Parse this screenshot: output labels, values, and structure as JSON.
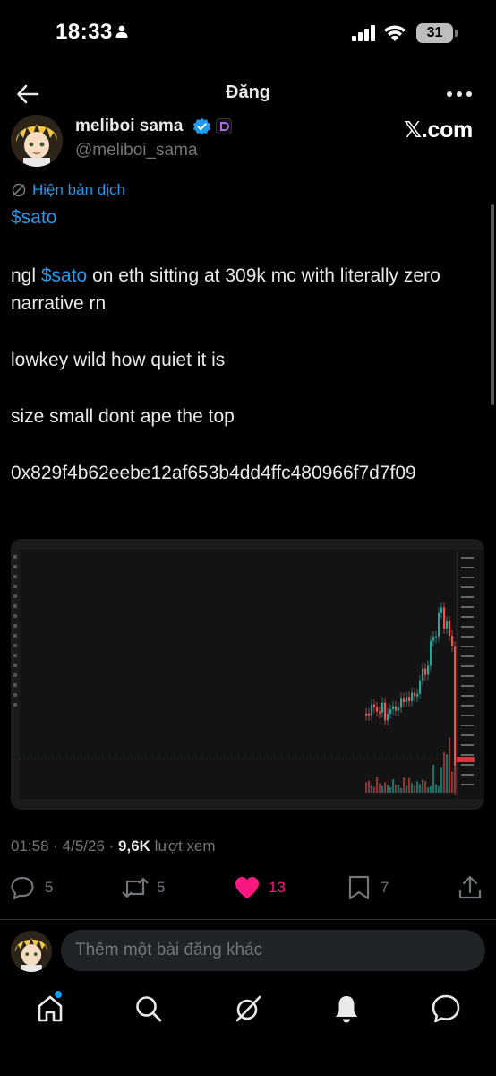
{
  "status_bar": {
    "time": "18:33",
    "battery": "31"
  },
  "header": {
    "title": "Đăng"
  },
  "author": {
    "name": "meliboi sama",
    "handle": "@meliboi_sama",
    "site": "𝕏.com"
  },
  "translate_label": "Hiện bản dịch",
  "post": {
    "cashtag_line": "$sato",
    "line1_prefix": "ngl ",
    "line1_tag": "$sato",
    "line1_suffix": " on eth sitting at 309k mc with literally zero narrative rn",
    "line2": "lowkey wild how quiet it is",
    "line3": "size small dont ape the top",
    "address": "0x829f4b62eebe12af653b4dd4ffc480966f7d7f09"
  },
  "meta": {
    "timestamp": "01:58 · 4/5/26 · ",
    "views": "9,6K",
    "views_suffix": " lượt xem"
  },
  "actions": {
    "replies": "5",
    "reposts": "5",
    "likes": "13",
    "bookmarks": "7"
  },
  "reply": {
    "placeholder": "Thêm một bài đăng khác"
  },
  "colors": {
    "accent": "#1d9bf0",
    "like": "#f91880",
    "background": "#000000",
    "muted": "#71767b"
  },
  "icons": {
    "nav": [
      "home-icon",
      "search-icon",
      "grok-icon",
      "notifications-icon",
      "messages-icon"
    ]
  }
}
